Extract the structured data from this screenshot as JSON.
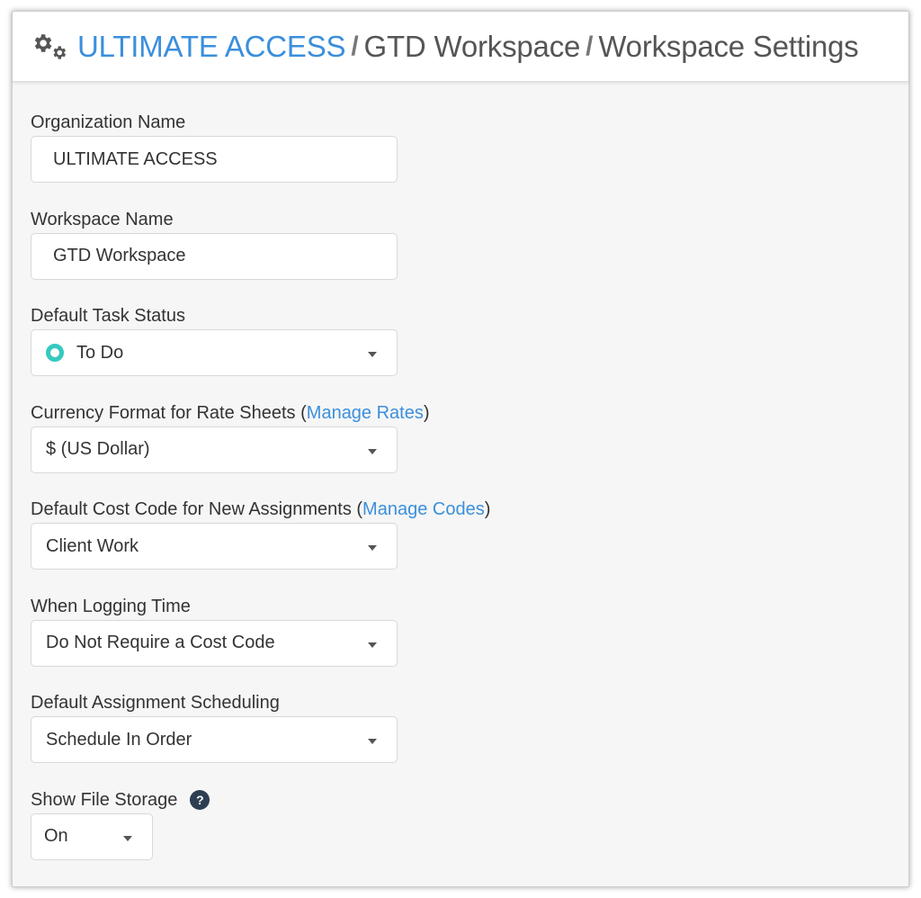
{
  "header": {
    "icon": "gears-icon",
    "breadcrumb": [
      {
        "label": "ULTIMATE ACCESS",
        "link": true
      },
      {
        "label": "GTD Workspace",
        "link": false
      },
      {
        "label": "Workspace Settings",
        "link": false
      }
    ],
    "separator": "/"
  },
  "form": {
    "organization_name": {
      "label": "Organization Name",
      "value": "ULTIMATE ACCESS"
    },
    "workspace_name": {
      "label": "Workspace Name",
      "value": "GTD Workspace"
    },
    "default_task_status": {
      "label": "Default Task Status",
      "value": "To Do",
      "status_color": "#35c9c0"
    },
    "currency_format": {
      "label": "Currency Format for Rate Sheets (",
      "link": "Manage Rates",
      "suffix": ")",
      "value": "$ (US Dollar)"
    },
    "default_cost_code": {
      "label": "Default Cost Code for New Assignments (",
      "link": "Manage Codes",
      "suffix": ")",
      "value": "Client Work"
    },
    "logging_time": {
      "label": "When Logging Time",
      "value": "Do Not Require a Cost Code"
    },
    "assignment_scheduling": {
      "label": "Default Assignment Scheduling",
      "value": "Schedule In Order"
    },
    "file_storage": {
      "label": "Show File Storage",
      "help": "?",
      "value": "On"
    }
  },
  "colors": {
    "link": "#3b8fdc",
    "status_teal": "#35c9c0",
    "help_bg": "#2e3e52"
  }
}
